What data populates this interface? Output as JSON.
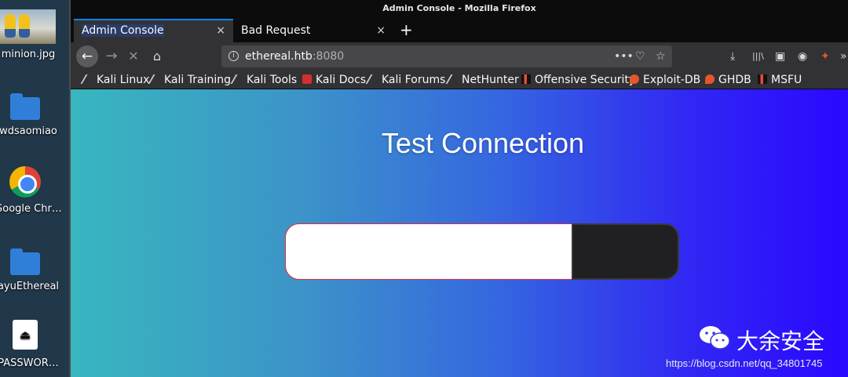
{
  "desktop": {
    "icons": [
      {
        "label": "minion.jpg",
        "icon": "image-thumbnail-icon"
      },
      {
        "label": "wdsaomiao",
        "icon": "folder-icon"
      },
      {
        "label": "Google Chr…",
        "icon": "chrome-icon"
      },
      {
        "label": "ayuEthereal",
        "icon": "folder-icon"
      },
      {
        "label": "PASSWOR…",
        "icon": "password-file-icon"
      }
    ]
  },
  "window": {
    "title": "Admin Console - Mozilla Firefox",
    "tabs": [
      {
        "label": "Admin Console",
        "active": true,
        "close": "×"
      },
      {
        "label": "Bad Request",
        "active": false,
        "close": "×"
      }
    ],
    "new_tab": "+",
    "nav": {
      "back": "←",
      "forward": "→",
      "stop": "✕",
      "home": "⌂"
    },
    "url": {
      "host": "ethereal.htb",
      "port": ":8080",
      "info": "i",
      "more": "•••",
      "pocket": "♡",
      "star": "☆"
    },
    "toolbar_right": {
      "download": "⤓",
      "library": "|||\\",
      "sidebar": "▣",
      "account": "◉",
      "extension": "✦",
      "overflow": "»"
    },
    "bookmarks": [
      {
        "label": "Kali Linux",
        "icon": "kali-dragon-icon"
      },
      {
        "label": "Kali Training",
        "icon": "kali-dragon-icon"
      },
      {
        "label": "Kali Tools",
        "icon": "kali-dragon-icon"
      },
      {
        "label": "Kali Docs",
        "icon": "pdf-icon"
      },
      {
        "label": "Kali Forums",
        "icon": "kali-dragon-icon"
      },
      {
        "label": "NetHunter",
        "icon": "kali-dragon-icon"
      },
      {
        "label": "Offensive Security",
        "icon": "offsec-icon"
      },
      {
        "label": "Exploit-DB",
        "icon": "exploitdb-icon"
      },
      {
        "label": "GHDB",
        "icon": "exploitdb-icon"
      },
      {
        "label": "MSFU",
        "icon": "offsec-icon"
      }
    ]
  },
  "page": {
    "title": "Test Connection",
    "input_value": "",
    "button_label": ""
  },
  "watermark": {
    "brand": "大余安全",
    "url": "https://blog.csdn.net/qq_34801745"
  }
}
